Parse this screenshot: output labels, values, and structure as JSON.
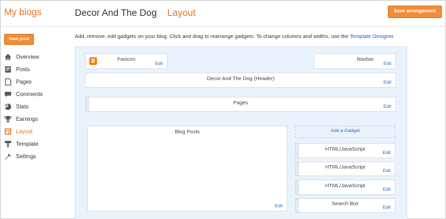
{
  "header": {
    "brand": "My blogs",
    "blog_name": "Decor And The Dog",
    "separator": "·",
    "section": "Layout",
    "save_label": "Save arrangement"
  },
  "sidebar": {
    "new_post": "New post",
    "items": [
      {
        "label": "Overview",
        "icon": "home-icon"
      },
      {
        "label": "Posts",
        "icon": "posts-icon"
      },
      {
        "label": "Pages",
        "icon": "pages-icon"
      },
      {
        "label": "Comments",
        "icon": "comments-icon"
      },
      {
        "label": "Stats",
        "icon": "stats-icon"
      },
      {
        "label": "Earnings",
        "icon": "trophy-icon"
      },
      {
        "label": "Layout",
        "icon": "layout-icon",
        "active": true
      },
      {
        "label": "Template",
        "icon": "template-icon"
      },
      {
        "label": "Settings",
        "icon": "wrench-icon"
      }
    ]
  },
  "description": {
    "text": "Add, remove, edit gadgets on your blog. Click and drag to rearrange gadgets. To change columns and widths, use the ",
    "link": "Template Designer",
    "end": "."
  },
  "layout": {
    "favicon": {
      "label": "Favicon",
      "edit": "Edit"
    },
    "navbar": {
      "label": "Navbar",
      "edit": "Edit"
    },
    "header": {
      "label": "Decor And The Dog (Header)",
      "edit": "Edit"
    },
    "pages": {
      "label": "Pages",
      "edit": "Edit"
    },
    "blog_posts": {
      "label": "Blog Posts",
      "edit": "Edit"
    },
    "add_gadget": "Add a Gadget",
    "gadgets": [
      {
        "label": "HTML/JavaScript",
        "edit": "Edit"
      },
      {
        "label": "HTML/JavaScript",
        "edit": "Edit"
      },
      {
        "label": "HTML/JavaScript",
        "edit": "Edit"
      },
      {
        "label": "Search Box",
        "edit": "Edit"
      }
    ]
  },
  "colors": {
    "accent": "#e8731f",
    "button": "#f48b35",
    "link": "#1a62c6",
    "layout_bg": "#eaf2fc"
  }
}
